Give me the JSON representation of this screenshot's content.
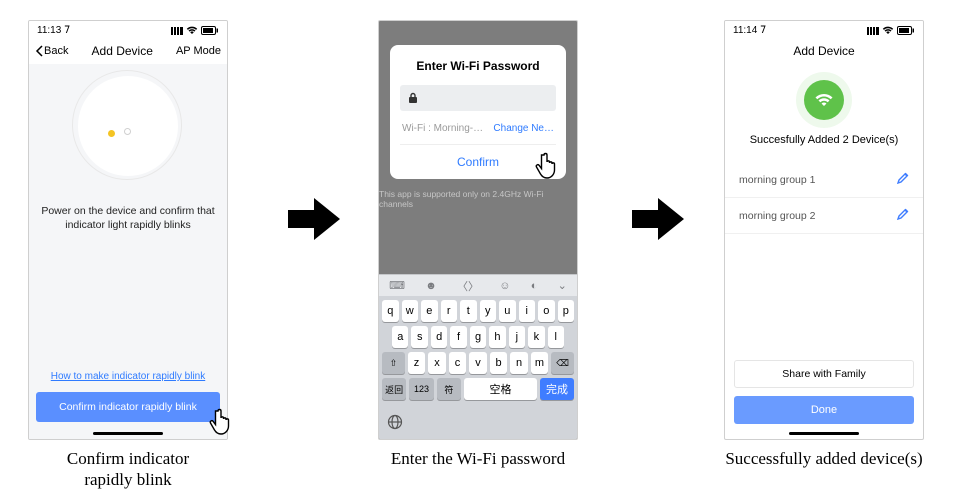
{
  "statusbar": {
    "time1": "11:13 ⁠𝟩",
    "time3": "11:14 ⁠𝟩"
  },
  "screen1": {
    "back": "Back",
    "title": "Add Device",
    "mode": "AP Mode",
    "instruction": "Power on the device and confirm that indicator light rapidly blinks",
    "help_link": "How to make indicator rapidly blink",
    "confirm_button": "Confirm indicator rapidly blink"
  },
  "screen2": {
    "modal_title": "Enter Wi-Fi Password",
    "wifi_label": "Wi-Fi : Morning-…",
    "change_network": "Change Ne…",
    "confirm": "Confirm",
    "footnote": "This app is supported only on 2.4GHz Wi-Fi channels",
    "keys_row1": [
      "q",
      "w",
      "e",
      "r",
      "t",
      "y",
      "u",
      "i",
      "o",
      "p"
    ],
    "keys_row2": [
      "a",
      "s",
      "d",
      "f",
      "g",
      "h",
      "j",
      "k",
      "l"
    ],
    "keys_row3": [
      "⇧",
      "z",
      "x",
      "c",
      "v",
      "b",
      "n",
      "m",
      "⌫"
    ],
    "fn_return": "返回",
    "fn_123": "123",
    "fn_sym": "符",
    "space": "空格",
    "done": "完成"
  },
  "screen3": {
    "title": "Add Device",
    "success": "Succesfully Added 2 Device(s)",
    "devices": [
      "morning group 1",
      "morning group 2"
    ],
    "share": "Share with Family",
    "done": "Done"
  },
  "captions": {
    "c1a": "Confirm indicator",
    "c1b": "rapidly blink",
    "c2": "Enter the Wi-Fi password",
    "c3": "Successfully added device(s)"
  }
}
